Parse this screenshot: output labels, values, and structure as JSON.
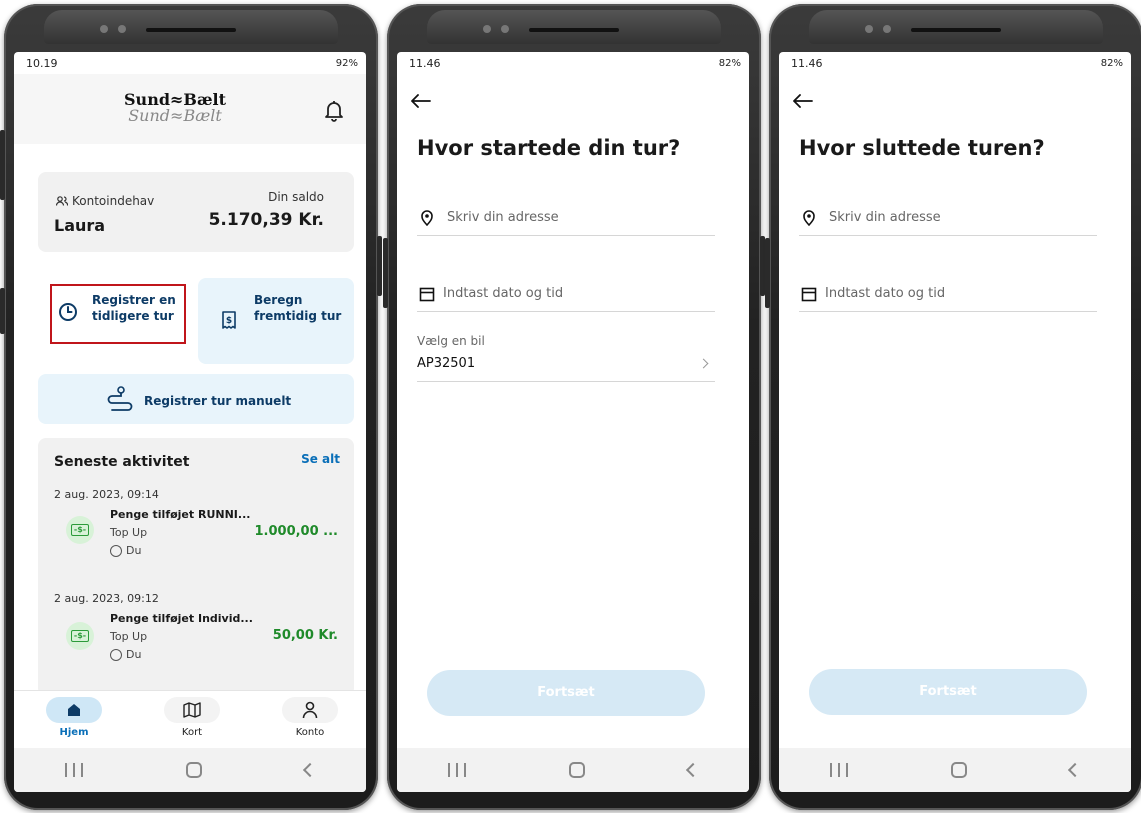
{
  "screen1": {
    "status": {
      "time": "10.19",
      "right": "92%"
    },
    "logo": {
      "line1": "Sund≈Bælt",
      "line2": "Sund≈Bælt"
    },
    "account": {
      "holder_label": "Kontoindehav",
      "holder_name": "Laura",
      "balance_label": "Din saldo",
      "balance_value": "5.170,39 Kr."
    },
    "tiles": {
      "register_past": "Registrer en tidligere tur",
      "calc_future": "Beregn fremtidig tur"
    },
    "manual_label": "Registrer tur manuelt",
    "activity": {
      "title": "Seneste aktivitet",
      "see_all": "Se alt",
      "items": [
        {
          "date": "2 aug. 2023, 09:14",
          "name": "Penge tilføjet RUNNI...",
          "type": "Top Up",
          "who": "Du",
          "amount": "1.000,00 ..."
        },
        {
          "date": "2 aug. 2023, 09:12",
          "name": "Penge tilføjet Individ...",
          "type": "Top Up",
          "who": "Du",
          "amount": "50,00 Kr."
        }
      ]
    },
    "bottomnav": {
      "home": "Hjem",
      "map": "Kort",
      "account": "Konto"
    }
  },
  "screen2": {
    "status": {
      "time": "11.46",
      "right": "82%"
    },
    "title": "Hvor startede din tur?",
    "address_placeholder": "Skriv din adresse",
    "datetime_placeholder": "Indtast dato og tid",
    "car_label": "Vælg en bil",
    "car_value": "AP32501",
    "continue": "Fortsæt"
  },
  "screen3": {
    "status": {
      "time": "11.46",
      "right": "82%"
    },
    "title": "Hvor sluttede turen?",
    "address_placeholder": "Skriv din adresse",
    "datetime_placeholder": "Indtast dato og tid",
    "continue": "Fortsæt"
  },
  "colors": {
    "brand_blue": "#0a6fb8",
    "tile_bg": "#e8f4fb",
    "highlight": "#c0151b",
    "amount_green": "#1f8a2a",
    "cta_disabled": "#d6e9f5"
  },
  "icons": [
    "bell-icon",
    "people-icon",
    "clock-icon",
    "receipt-icon",
    "route-icon",
    "money-icon",
    "user-circle-icon",
    "home-icon",
    "map-icon",
    "person-icon",
    "back-arrow-icon",
    "location-pin-icon",
    "calendar-icon",
    "chevron-right-icon"
  ]
}
